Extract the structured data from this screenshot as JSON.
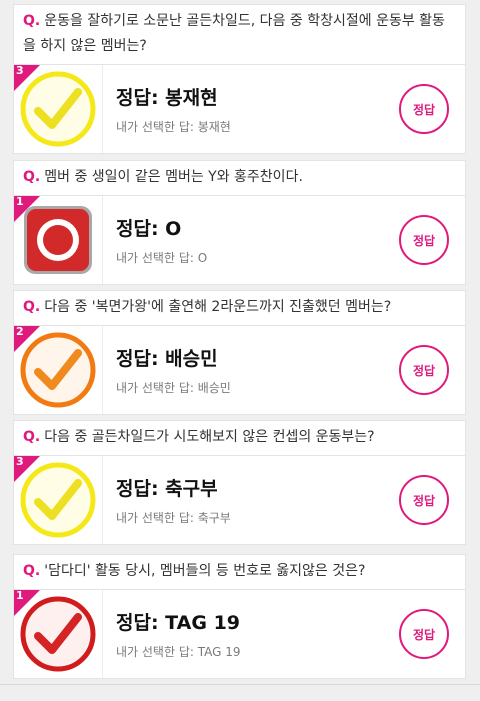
{
  "marker": "Q.",
  "questions": [
    {
      "text": "운동을 잘하기로 소문난 골든차일드, 다음 중 학창시절에 운동부 활동을 하지 않은 멤버는?",
      "rank": "3",
      "icon": "yellow-check-icon",
      "answer": "정답: 봉재현",
      "selected": "내가 선택한 답: 봉재현",
      "button": "정답"
    },
    {
      "text": "멤버 중 생일이 같은 멤버는 Y와 홍주찬이다.",
      "rank": "1",
      "icon": "red-circle-icon",
      "answer": "정답: O",
      "selected": "내가 선택한 답: O",
      "button": "정답"
    },
    {
      "text": "다음 중 '복면가왕'에 출연해 2라운드까지 진출했던 멤버는?",
      "rank": "2",
      "icon": "orange-check-icon",
      "answer": "정답: 배승민",
      "selected": "내가 선택한 답: 배승민",
      "button": "정답"
    },
    {
      "text": "다음 중 골든차일드가 시도해보지 않은 컨셉의 운동부는?",
      "rank": "3",
      "icon": "yellow-check-icon",
      "answer": "정답: 축구부",
      "selected": "내가 선택한 답: 축구부",
      "button": "정답"
    },
    {
      "text": "'담다디' 활동 당시, 멤버들의 등 번호로 옳지않은 것은?",
      "rank": "1",
      "icon": "red-check-icon",
      "answer": "정답: TAG 19",
      "selected": "내가 선택한 답: TAG 19",
      "button": "정답"
    }
  ]
}
